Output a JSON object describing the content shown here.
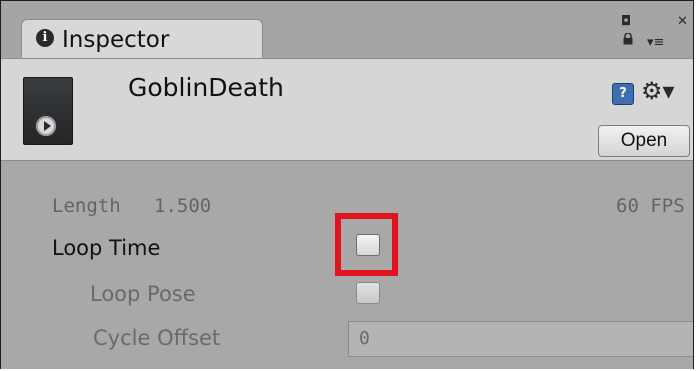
{
  "tab": {
    "title": "Inspector",
    "info_glyph": "i"
  },
  "window_controls": {
    "restore_glyph": "◘",
    "close_glyph": "✕",
    "menu_glyph": "▾≡"
  },
  "asset": {
    "name": "GoblinDeath",
    "open_label": "Open",
    "help_glyph": "?",
    "gear_glyph": "⚙▾"
  },
  "clip": {
    "length_label": "Length",
    "length_value": "1.500",
    "fps_text": "60 FPS",
    "loop_time_label": "Loop Time",
    "loop_time_checked": false,
    "loop_pose_label": "Loop Pose",
    "loop_pose_checked": false,
    "cycle_offset_label": "Cycle Offset",
    "cycle_offset_value": "0"
  },
  "colors": {
    "highlight": "#e0141e",
    "panel": "#a8a8a8",
    "header": "#d6d6d6"
  }
}
